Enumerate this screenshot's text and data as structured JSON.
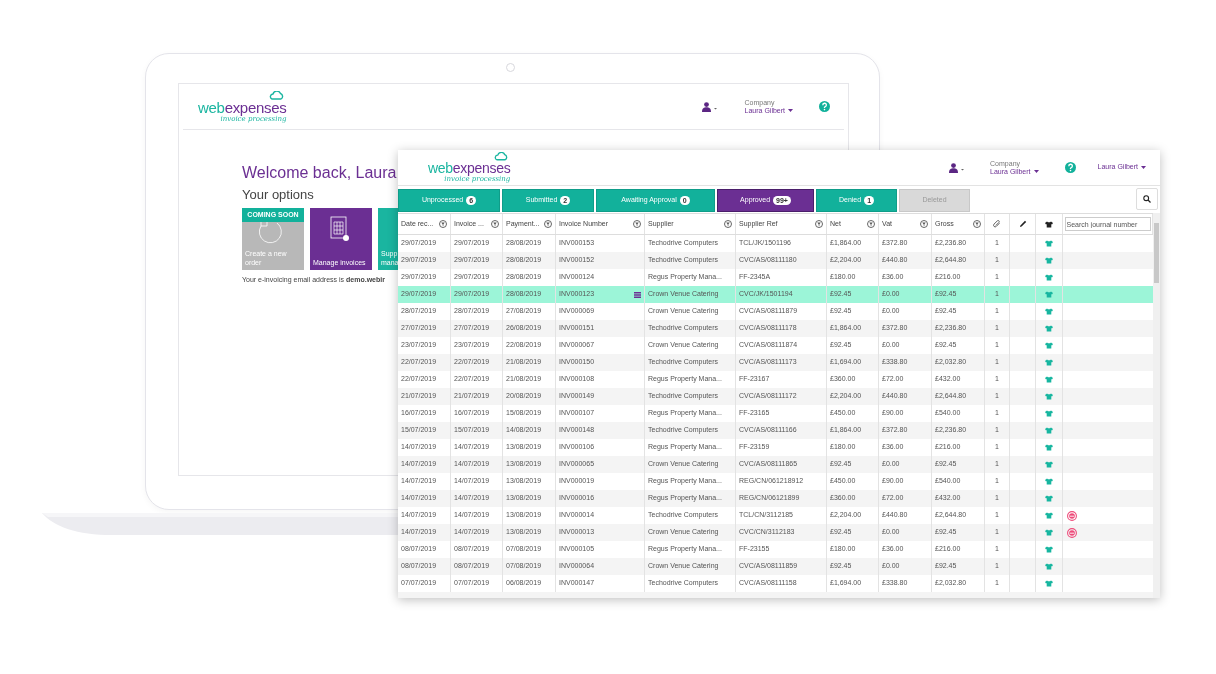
{
  "back_screen": {
    "logo": {
      "word_1": "web",
      "word_2": "expenses",
      "tagline": "invoice processing"
    },
    "header": {
      "company_label": "Company",
      "company_name": "Laura Gilbert"
    },
    "welcome": "Welcome back, Laura",
    "options_title": "Your options",
    "tiles": [
      {
        "kind": "order",
        "color": "#b8b8b8",
        "badge": "COMING SOON",
        "lines": [
          "Create a new",
          "order"
        ]
      },
      {
        "kind": "invoices",
        "color": "#6b2f93",
        "lines": [
          "Manage invoices"
        ]
      },
      {
        "kind": "cut",
        "color": "#1ab5a0",
        "lines": [
          "Supp",
          "mana"
        ]
      }
    ],
    "email_line": "Your e-invoicing email address is **demo.webir**"
  },
  "front_window": {
    "logo": {
      "word_1": "web",
      "word_2": "expenses",
      "tagline": "invoice processing"
    },
    "header": {
      "company_label": "Company",
      "company_name": "Laura Gilbert",
      "user_menu": "Laura Gilbert"
    },
    "tabs": [
      {
        "label": "Unprocessed",
        "count": "6",
        "selected": false,
        "disabled": false
      },
      {
        "label": "Submitted",
        "count": "2",
        "selected": false,
        "disabled": false
      },
      {
        "label": "Awaiting Approval",
        "count": "0",
        "selected": false,
        "disabled": false
      },
      {
        "label": "Approved",
        "count": "99+",
        "selected": true,
        "disabled": false
      },
      {
        "label": "Denied",
        "count": "1",
        "selected": false,
        "disabled": false
      },
      {
        "label": "Deleted",
        "selected": false,
        "disabled": true
      }
    ],
    "table": {
      "columns": [
        {
          "kind": "text",
          "label": "Date rec..."
        },
        {
          "kind": "text",
          "label": "Invoice ..."
        },
        {
          "kind": "text",
          "label": "Payment..."
        },
        {
          "kind": "text",
          "label": "Invoice Number"
        },
        {
          "kind": "text",
          "label": "Supplier"
        },
        {
          "kind": "text",
          "label": "Supplier Ref"
        },
        {
          "kind": "text",
          "label": "Net"
        },
        {
          "kind": "text",
          "label": "Vat"
        },
        {
          "kind": "text",
          "label": "Gross"
        },
        {
          "kind": "attachment"
        },
        {
          "kind": "edit"
        },
        {
          "kind": "status"
        },
        {
          "kind": "journal",
          "placeholder": "Search journal number"
        }
      ],
      "rows": [
        {
          "cells": [
            "29/07/2019",
            "29/07/2019",
            "28/08/2019",
            "INV000153",
            "Techodrive Computers",
            "TCL/JK/1501196",
            "£1,864.00",
            "£372.80",
            "£2,236.80"
          ],
          "attachments": "1",
          "selected": false,
          "note": false,
          "alert": false
        },
        {
          "cells": [
            "29/07/2019",
            "29/07/2019",
            "28/08/2019",
            "INV000152",
            "Techodrive Computers",
            "CVC/AS/08111180",
            "£2,204.00",
            "£440.80",
            "£2,644.80"
          ],
          "attachments": "1",
          "selected": false,
          "note": false,
          "alert": false
        },
        {
          "cells": [
            "29/07/2019",
            "29/07/2019",
            "28/08/2019",
            "INV000124",
            "Regus Property Mana...",
            "FF-2345A",
            "£180.00",
            "£36.00",
            "£216.00"
          ],
          "attachments": "1",
          "selected": false,
          "note": false,
          "alert": false
        },
        {
          "cells": [
            "29/07/2019",
            "29/07/2019",
            "28/08/2019",
            "INV000123",
            "Crown Venue Catering",
            "CVC/JK/1501194",
            "£92.45",
            "£0.00",
            "£92.45"
          ],
          "attachments": "1",
          "selected": true,
          "note": true,
          "alert": false
        },
        {
          "cells": [
            "28/07/2019",
            "28/07/2019",
            "27/08/2019",
            "INV000069",
            "Crown Venue Catering",
            "CVC/AS/08111879",
            "£92.45",
            "£0.00",
            "£92.45"
          ],
          "attachments": "1",
          "selected": false,
          "note": false,
          "alert": false
        },
        {
          "cells": [
            "27/07/2019",
            "27/07/2019",
            "26/08/2019",
            "INV000151",
            "Techodrive Computers",
            "CVC/AS/08111178",
            "£1,864.00",
            "£372.80",
            "£2,236.80"
          ],
          "attachments": "1",
          "selected": false,
          "note": false,
          "alert": false
        },
        {
          "cells": [
            "23/07/2019",
            "23/07/2019",
            "22/08/2019",
            "INV000067",
            "Crown Venue Catering",
            "CVC/AS/08111874",
            "£92.45",
            "£0.00",
            "£92.45"
          ],
          "attachments": "1",
          "selected": false,
          "note": false,
          "alert": false
        },
        {
          "cells": [
            "22/07/2019",
            "22/07/2019",
            "21/08/2019",
            "INV000150",
            "Techodrive Computers",
            "CVC/AS/08111173",
            "£1,694.00",
            "£338.80",
            "£2,032.80"
          ],
          "attachments": "1",
          "selected": false,
          "note": false,
          "alert": false
        },
        {
          "cells": [
            "22/07/2019",
            "22/07/2019",
            "21/08/2019",
            "INV000108",
            "Regus Property Mana...",
            "FF-23167",
            "£360.00",
            "£72.00",
            "£432.00"
          ],
          "attachments": "1",
          "selected": false,
          "note": false,
          "alert": false
        },
        {
          "cells": [
            "21/07/2019",
            "21/07/2019",
            "20/08/2019",
            "INV000149",
            "Techodrive Computers",
            "CVC/AS/08111172",
            "£2,204.00",
            "£440.80",
            "£2,644.80"
          ],
          "attachments": "1",
          "selected": false,
          "note": false,
          "alert": false
        },
        {
          "cells": [
            "16/07/2019",
            "16/07/2019",
            "15/08/2019",
            "INV000107",
            "Regus Property Mana...",
            "FF-23165",
            "£450.00",
            "£90.00",
            "£540.00"
          ],
          "attachments": "1",
          "selected": false,
          "note": false,
          "alert": false
        },
        {
          "cells": [
            "15/07/2019",
            "15/07/2019",
            "14/08/2019",
            "INV000148",
            "Techodrive Computers",
            "CVC/AS/08111166",
            "£1,864.00",
            "£372.80",
            "£2,236.80"
          ],
          "attachments": "1",
          "selected": false,
          "note": false,
          "alert": false
        },
        {
          "cells": [
            "14/07/2019",
            "14/07/2019",
            "13/08/2019",
            "INV000106",
            "Regus Property Mana...",
            "FF-23159",
            "£180.00",
            "£36.00",
            "£216.00"
          ],
          "attachments": "1",
          "selected": false,
          "note": false,
          "alert": false
        },
        {
          "cells": [
            "14/07/2019",
            "14/07/2019",
            "13/08/2019",
            "INV000065",
            "Crown Venue Catering",
            "CVC/AS/08111865",
            "£92.45",
            "£0.00",
            "£92.45"
          ],
          "attachments": "1",
          "selected": false,
          "note": false,
          "alert": false
        },
        {
          "cells": [
            "14/07/2019",
            "14/07/2019",
            "13/08/2019",
            "INV000019",
            "Regus Property Mana...",
            "REG/CN/061218912",
            "£450.00",
            "£90.00",
            "£540.00"
          ],
          "attachments": "1",
          "selected": false,
          "note": false,
          "alert": false
        },
        {
          "cells": [
            "14/07/2019",
            "14/07/2019",
            "13/08/2019",
            "INV000016",
            "Regus Property Mana...",
            "REG/CN/06121899",
            "£360.00",
            "£72.00",
            "£432.00"
          ],
          "attachments": "1",
          "selected": false,
          "note": false,
          "alert": false
        },
        {
          "cells": [
            "14/07/2019",
            "14/07/2019",
            "13/08/2019",
            "INV000014",
            "Techodrive Computers",
            "TCL/CN/3112185",
            "£2,204.00",
            "£440.80",
            "£2,644.80"
          ],
          "attachments": "1",
          "selected": false,
          "note": false,
          "alert": true
        },
        {
          "cells": [
            "14/07/2019",
            "14/07/2019",
            "13/08/2019",
            "INV000013",
            "Crown Venue Catering",
            "CVC/CN/3112183",
            "£92.45",
            "£0.00",
            "£92.45"
          ],
          "attachments": "1",
          "selected": false,
          "note": false,
          "alert": true
        },
        {
          "cells": [
            "08/07/2019",
            "08/07/2019",
            "07/08/2019",
            "INV000105",
            "Regus Property Mana...",
            "FF-23155",
            "£180.00",
            "£36.00",
            "£216.00"
          ],
          "attachments": "1",
          "selected": false,
          "note": false,
          "alert": false
        },
        {
          "cells": [
            "08/07/2019",
            "08/07/2019",
            "07/08/2019",
            "INV000064",
            "Crown Venue Catering",
            "CVC/AS/08111859",
            "£92.45",
            "£0.00",
            "£92.45"
          ],
          "attachments": "1",
          "selected": false,
          "note": false,
          "alert": false
        },
        {
          "cells": [
            "07/07/2019",
            "07/07/2019",
            "06/08/2019",
            "INV000147",
            "Techodrive Computers",
            "CVC/AS/08111158",
            "£1,694.00",
            "£338.80",
            "£2,032.80"
          ],
          "attachments": "1",
          "selected": false,
          "note": false,
          "alert": false
        }
      ]
    }
  }
}
